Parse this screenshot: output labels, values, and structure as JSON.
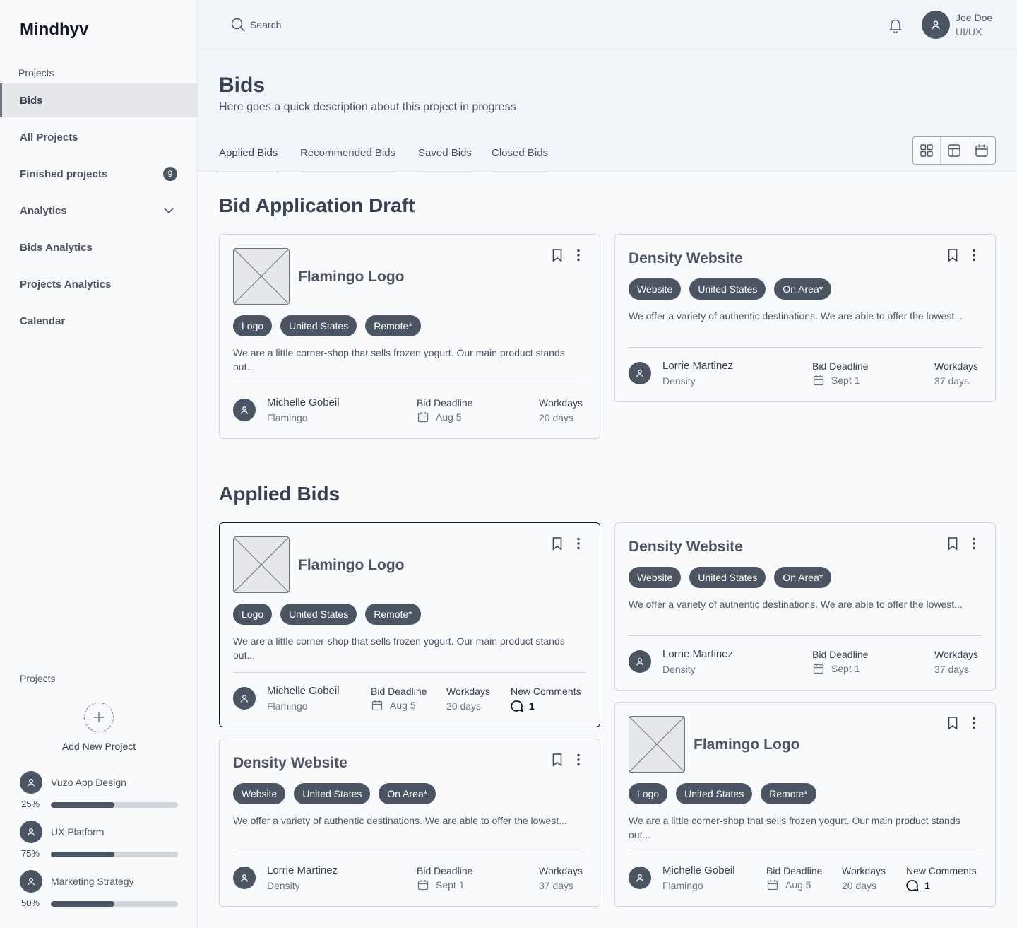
{
  "app": {
    "brand": "Mindhyv"
  },
  "sidebar": {
    "section_label": "Projects",
    "items": [
      {
        "label": "Bids"
      },
      {
        "label": "All Projects"
      },
      {
        "label": "Finished projects",
        "badge": "9"
      },
      {
        "label": "Analytics"
      },
      {
        "label": "Bids Analytics"
      },
      {
        "label": "Projects Analytics"
      },
      {
        "label": "Calendar"
      }
    ],
    "projects_label": "Projects",
    "add_label": "Add New Project",
    "projects": [
      {
        "name": "Vuzo App Design",
        "percent_label": "25%",
        "progress": 0.5
      },
      {
        "name": "UX Platform",
        "percent_label": "75%",
        "progress": 0.5
      },
      {
        "name": "Marketing Strategy",
        "percent_label": "50%",
        "progress": 0.5
      }
    ]
  },
  "topbar": {
    "search_placeholder": "Search",
    "user_name": "Joe Doe",
    "user_role": "UI/UX"
  },
  "page": {
    "title": "Bids",
    "description": "Here goes a quick description about this project in progress",
    "tabs": [
      "Applied Bids",
      "Recommended Bids",
      "Saved Bids",
      "Closed Bids"
    ],
    "view_icons": [
      "grid-icon",
      "layout-icon",
      "calendar-icon"
    ]
  },
  "sections": {
    "draft_title": "Bid Application Draft",
    "applied_title": "Applied Bids"
  },
  "labels": {
    "bid_deadline": "Bid Deadline",
    "workdays": "Workdays",
    "new_comments": "New Comments"
  },
  "cards": {
    "flamingo": {
      "title": "Flamingo Logo",
      "tags": [
        "Logo",
        "United States",
        "Remote*"
      ],
      "desc": "We are a little corner-shop that sells frozen yogurt. Our main product stands out...",
      "person": "Michelle Gobeil",
      "company": "Flamingo",
      "deadline": "Aug 5",
      "workdays": "20 days",
      "comments": "1"
    },
    "density": {
      "title": "Density Website",
      "tags": [
        "Website",
        "United States",
        "On Area*"
      ],
      "desc": "We offer a variety of authentic destinations. We are able to offer the lowest...",
      "person": "Lorrie Martinez",
      "company": "Density",
      "deadline": "Sept 1",
      "workdays": "37 days"
    }
  },
  "colors": {
    "accent": "#4b5563",
    "background": "#f8fafc",
    "header_bg": "#f1f5f9"
  }
}
